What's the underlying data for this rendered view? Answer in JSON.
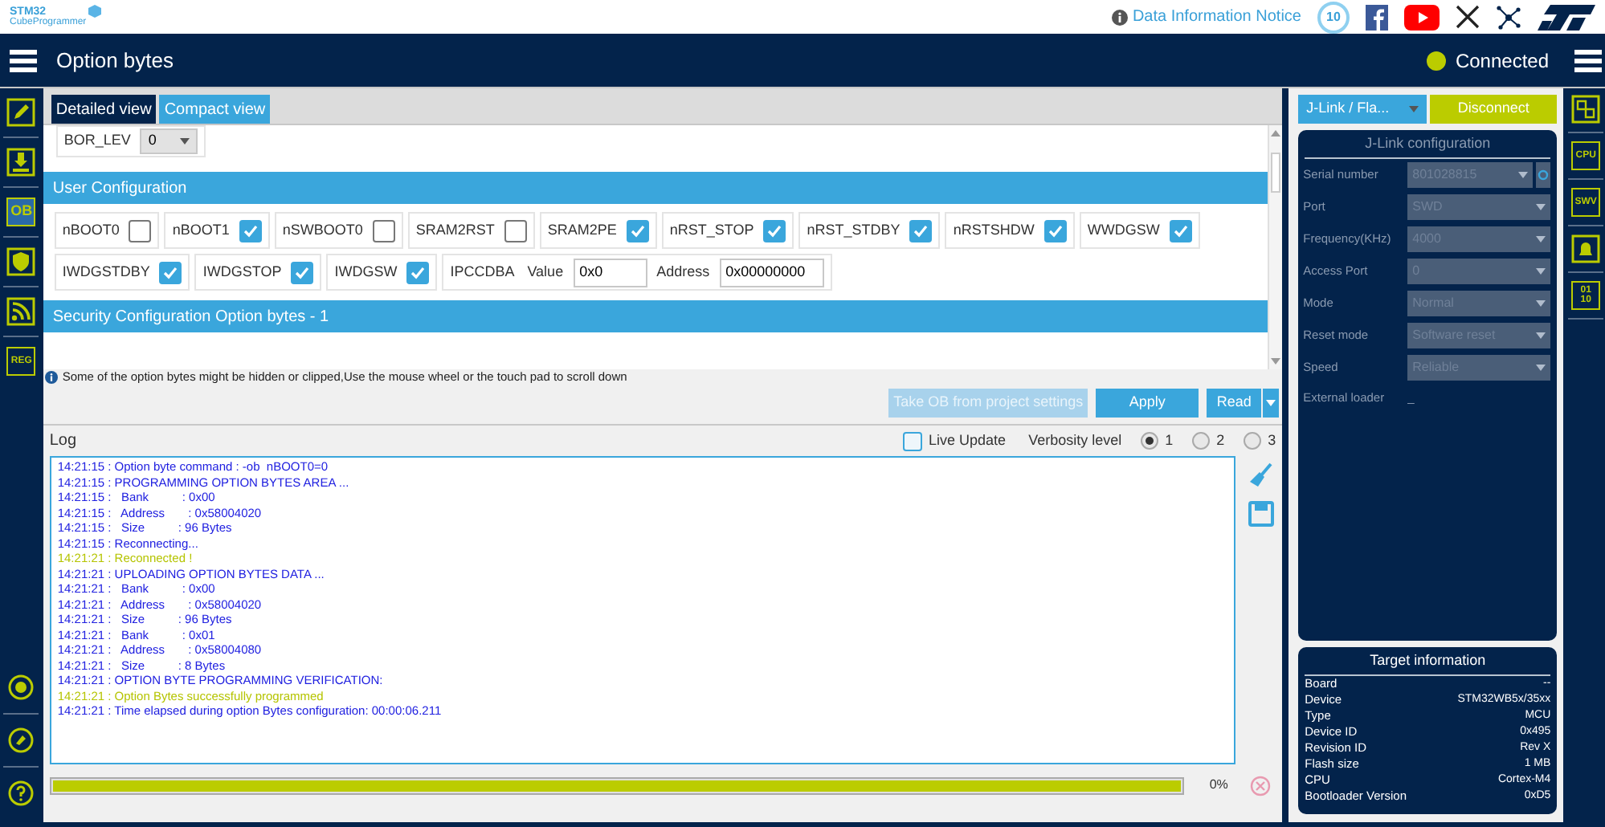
{
  "header": {
    "logo": {
      "line1": "STM32",
      "line2": "CubeProgrammer"
    },
    "notice": "Data Information Notice",
    "badge": "10"
  },
  "title": "Option bytes",
  "status": {
    "label": "Connected",
    "connected": true
  },
  "left_nav": [
    {
      "selected": false
    },
    {
      "selected": false
    },
    {
      "label": "OB",
      "selected": true
    },
    {
      "selected": false
    },
    {
      "selected": false
    },
    {
      "label": "REG",
      "selected": false
    }
  ],
  "tabs": [
    {
      "label": "Detailed view",
      "selected": true
    },
    {
      "label": "Compact view",
      "selected": false
    }
  ],
  "bor": {
    "label": "BOR_LEV",
    "value": "0"
  },
  "sections": [
    "User Configuration",
    "Security Configuration Option bytes - 1"
  ],
  "options": [
    {
      "kind": "checkbox",
      "label": "nBOOT0",
      "checked": false
    },
    {
      "kind": "checkbox",
      "label": "nBOOT1",
      "checked": true
    },
    {
      "kind": "checkbox",
      "label": "nSWBOOT0",
      "checked": false
    },
    {
      "kind": "checkbox",
      "label": "SRAM2RST",
      "checked": false
    },
    {
      "kind": "checkbox",
      "label": "SRAM2PE",
      "checked": true
    },
    {
      "kind": "checkbox",
      "label": "nRST_STOP",
      "checked": true
    },
    {
      "kind": "checkbox",
      "label": "nRST_STDBY",
      "checked": true
    },
    {
      "kind": "checkbox",
      "label": "nRSTSHDW",
      "checked": true
    },
    {
      "kind": "checkbox",
      "label": "WWDGSW",
      "checked": true
    },
    {
      "kind": "checkbox",
      "label": "IWDGSTDBY",
      "checked": true
    },
    {
      "kind": "checkbox",
      "label": "IWDGSTOP",
      "checked": true
    },
    {
      "kind": "checkbox",
      "label": "IWDGSW",
      "checked": true
    },
    {
      "kind": "fields",
      "label": "IPCCDBA",
      "fields": [
        {
          "label": "Value",
          "value": "0x0"
        },
        {
          "label": "Address",
          "value": "0x00000000"
        }
      ]
    }
  ],
  "hint": "Some of the option bytes might be hidden or clipped,Use the mouse wheel or the touch pad to scroll down",
  "buttons": [
    {
      "label": "Take OB from project settings",
      "disabled": true
    },
    {
      "label": "Apply",
      "disabled": false
    },
    {
      "label": "Read",
      "disabled": false
    }
  ],
  "log": {
    "title": "Log",
    "live_update": {
      "label": "Live Update",
      "checked": false
    },
    "verbosity": "Verbosity level",
    "levels": [
      {
        "label": "1",
        "selected": true
      },
      {
        "label": "2",
        "selected": false
      },
      {
        "label": "3",
        "selected": false
      }
    ],
    "lines": [
      {
        "kind": "info",
        "text": "14:21:15 : Option byte command : -ob  nBOOT0=0"
      },
      {
        "kind": "info",
        "text": "14:21:15 : PROGRAMMING OPTION BYTES AREA ..."
      },
      {
        "kind": "info",
        "text": "14:21:15 :   Bank          : 0x00"
      },
      {
        "kind": "info",
        "text": "14:21:15 :   Address       : 0x58004020"
      },
      {
        "kind": "info",
        "text": "14:21:15 :   Size          : 96 Bytes"
      },
      {
        "kind": "info",
        "text": "14:21:15 : Reconnecting..."
      },
      {
        "kind": "success",
        "text": "14:21:21 : Reconnected !"
      },
      {
        "kind": "info",
        "text": "14:21:21 : UPLOADING OPTION BYTES DATA ..."
      },
      {
        "kind": "info",
        "text": "14:21:21 :   Bank          : 0x00"
      },
      {
        "kind": "info",
        "text": "14:21:21 :   Address       : 0x58004020"
      },
      {
        "kind": "info",
        "text": "14:21:21 :   Size          : 96 Bytes"
      },
      {
        "kind": "info",
        "text": "14:21:21 :   Bank          : 0x01"
      },
      {
        "kind": "info",
        "text": "14:21:21 :   Address       : 0x58004080"
      },
      {
        "kind": "info",
        "text": "14:21:21 :   Size          : 8 Bytes"
      },
      {
        "kind": "info",
        "text": "14:21:21 : OPTION BYTE PROGRAMMING VERIFICATION:"
      },
      {
        "kind": "success",
        "text": "14:21:21 : Option Bytes successfully programmed"
      },
      {
        "kind": "info",
        "text": "14:21:21 : Time elapsed during option Bytes configuration: 00:00:06.211"
      }
    ]
  },
  "progress": {
    "level": 1,
    "reading": "0%"
  },
  "probe": {
    "value": "J-Link / Fla...",
    "action": "Disconnect"
  },
  "config": {
    "title": "J-Link configuration",
    "fields": [
      {
        "label": "Serial number",
        "value": "801028815"
      },
      {
        "label": "Port",
        "value": "SWD"
      },
      {
        "label": "Frequency(KHz)",
        "value": "4000"
      },
      {
        "label": "Access Port",
        "value": "0"
      },
      {
        "label": "Mode",
        "value": "Normal"
      },
      {
        "label": "Reset mode",
        "value": "Software reset"
      },
      {
        "label": "Speed",
        "value": "Reliable"
      }
    ],
    "external_loader": {
      "label": "External loader",
      "value": "_"
    }
  },
  "target": {
    "title": "Target information",
    "rows": [
      {
        "label": "Board",
        "value": "--"
      },
      {
        "label": "Device",
        "value": "STM32WB5x/35xx"
      },
      {
        "label": "Type",
        "value": "MCU"
      },
      {
        "label": "Device ID",
        "value": "0x495"
      },
      {
        "label": "Revision ID",
        "value": "Rev X"
      },
      {
        "label": "Flash size",
        "value": "1 MB"
      },
      {
        "label": "CPU",
        "value": "Cortex-M4"
      },
      {
        "label": "Bootloader Version",
        "value": "0xD5"
      }
    ]
  },
  "right_nav": [
    {
      "kind": "icon"
    },
    {
      "kind": "text",
      "label": "CPU"
    },
    {
      "kind": "text",
      "label": "SWV"
    },
    {
      "kind": "icon"
    },
    {
      "kind": "text",
      "label": "01 10"
    }
  ]
}
